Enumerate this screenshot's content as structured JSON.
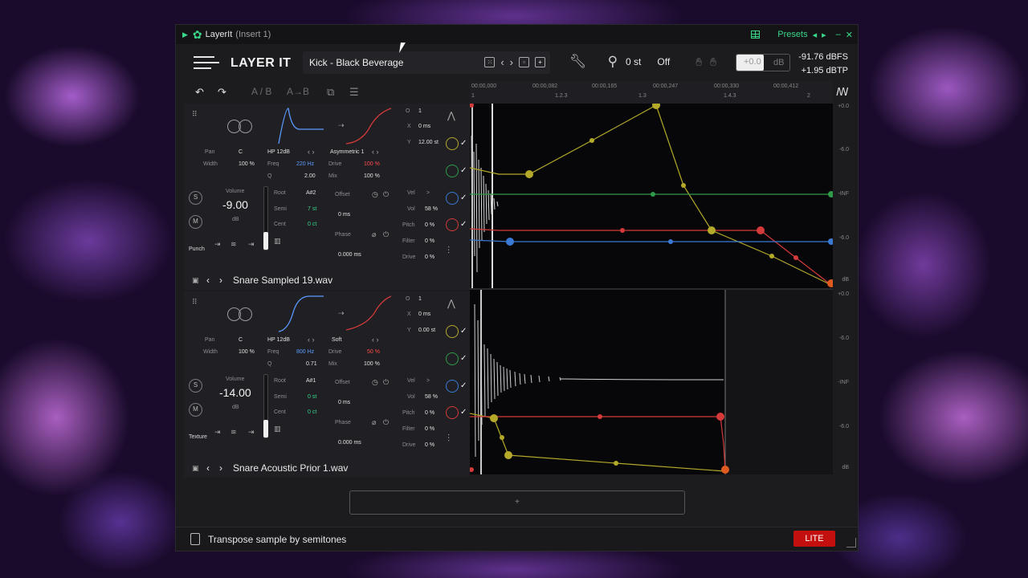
{
  "window": {
    "title": "LayerIt",
    "insert": "(Insert 1)",
    "presets_label": "Presets"
  },
  "header": {
    "brand": "LAYER IT",
    "preset_name": "Kick - Black Beverage",
    "semitone": "0 st",
    "off_label": "Off",
    "gain_value": "+0.0",
    "gain_unit": "dB",
    "dbfs": "-91.76 dBFS",
    "dbtp": "+1.95 dBTP"
  },
  "toolbar": {
    "ab": "A / B",
    "a_to_b": "A→B"
  },
  "ruler": {
    "ticks": [
      "00:00,000",
      "00:00,082",
      "00:00,165",
      "00:00,247",
      "00:00,330",
      "00:00,412"
    ],
    "bars": [
      "1",
      "1.2.3",
      "1.3",
      "1.4.3",
      "2"
    ]
  },
  "db_scale": [
    "+0.0",
    "-6.0",
    "-INF",
    "-6.0",
    "dB"
  ],
  "layers": [
    {
      "pan_label": "Pan",
      "pan": "C",
      "width_label": "Width",
      "width": "100 %",
      "filter_type": "HP 12dB",
      "freq_label": "Freq",
      "freq": "220 Hz",
      "q_label": "Q",
      "q": "2.00",
      "dist_type": "Asymmetric 1",
      "drive_label": "Drive",
      "drive": "100 %",
      "mix_label": "Mix",
      "mix": "100 %",
      "o_label": "O",
      "o": "1",
      "x_label": "X",
      "x": "0 ms",
      "y_label": "Y",
      "y": "12.00 st",
      "volume_label": "Volume",
      "volume": "-9.00",
      "volume_unit": "dB",
      "root_label": "Root",
      "root": "A#2",
      "semi_label": "Semi",
      "semi": "7 st",
      "cent_label": "Cent",
      "cent": "0 ct",
      "offset_label": "Offset",
      "offset": "0 ms",
      "phase_label": "Phase",
      "phase": "0.000 ms",
      "vel_label": "Vel",
      "vel": ">",
      "vol_label": "Vol",
      "vol": "58 %",
      "pitch_label": "Pitch",
      "pitch": "0 %",
      "filter_label": "Filter",
      "filter": "0 %",
      "drv_label": "Drive",
      "drv": "0 %",
      "mode": "Punch",
      "s": "S",
      "m": "M",
      "file": "Snare Sampled 19.wav"
    },
    {
      "pan_label": "Pan",
      "pan": "C",
      "width_label": "Width",
      "width": "100 %",
      "filter_type": "HP 12dB",
      "freq_label": "Freq",
      "freq": "800 Hz",
      "q_label": "Q",
      "q": "0.71",
      "dist_type": "Soft",
      "drive_label": "Drive",
      "drive": "50 %",
      "mix_label": "Mix",
      "mix": "100 %",
      "o_label": "O",
      "o": "1",
      "x_label": "X",
      "x": "0 ms",
      "y_label": "Y",
      "y": "0.00 st",
      "volume_label": "Volume",
      "volume": "-14.00",
      "volume_unit": "dB",
      "root_label": "Root",
      "root": "A#1",
      "semi_label": "Semi",
      "semi": "0 st",
      "cent_label": "Cent",
      "cent": "0 ct",
      "offset_label": "Offset",
      "offset": "0 ms",
      "phase_label": "Phase",
      "phase": "0.000 ms",
      "vel_label": "Vel",
      "vel": ">",
      "vol_label": "Vol",
      "vol": "58 %",
      "pitch_label": "Pitch",
      "pitch": "0 %",
      "filter_label": "Filter",
      "filter": "0 %",
      "drv_label": "Drive",
      "drv": "0 %",
      "mode": "Texture",
      "s": "S",
      "m": "M",
      "file": "Snare Acoustic Prior 1.wav"
    }
  ],
  "add_layer": "+",
  "status": {
    "hint": "Transpose sample by semitones",
    "badge": "LITE"
  },
  "colors": {
    "accent_green": "#3ad68a",
    "envelope_yellow": "#b5a92a",
    "envelope_red": "#d43a3a",
    "envelope_blue": "#3a7ad4",
    "envelope_green": "#2f9a4a",
    "lite_red": "#c40f0f"
  }
}
